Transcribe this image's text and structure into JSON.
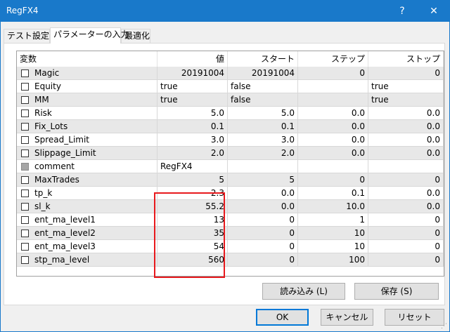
{
  "window": {
    "title": "RegFX4",
    "help_label": "?",
    "close_label": "✕"
  },
  "tabs": [
    {
      "label": "テスト設定"
    },
    {
      "label": "パラメーターの入力"
    },
    {
      "label": "最適化"
    }
  ],
  "table": {
    "headers": [
      "変数",
      "値",
      "スタート",
      "ステップ",
      "ストップ"
    ],
    "rows": [
      {
        "name": "Magic",
        "value": "20191004",
        "start": "20191004",
        "step": "0",
        "stop": "0"
      },
      {
        "name": "Equity",
        "value": "true",
        "start": "false",
        "step": "",
        "stop": "true"
      },
      {
        "name": "MM",
        "value": "true",
        "start": "false",
        "step": "",
        "stop": "true"
      },
      {
        "name": "Risk",
        "value": "5.0",
        "start": "5.0",
        "step": "0.0",
        "stop": "0.0"
      },
      {
        "name": "Fix_Lots",
        "value": "0.1",
        "start": "0.1",
        "step": "0.0",
        "stop": "0.0"
      },
      {
        "name": "Spread_Limit",
        "value": "3.0",
        "start": "3.0",
        "step": "0.0",
        "stop": "0.0"
      },
      {
        "name": "Slippage_Limit",
        "value": "2.0",
        "start": "2.0",
        "step": "0.0",
        "stop": "0.0"
      },
      {
        "name": "comment",
        "value": "RegFX4",
        "start": "",
        "step": "",
        "stop": ""
      },
      {
        "name": "MaxTrades",
        "value": "5",
        "start": "5",
        "step": "0",
        "stop": "0"
      },
      {
        "name": "tp_k",
        "value": "2.3",
        "start": "0.0",
        "step": "0.1",
        "stop": "0.0"
      },
      {
        "name": "sl_k",
        "value": "55.2",
        "start": "0.0",
        "step": "10.0",
        "stop": "0.0"
      },
      {
        "name": "ent_ma_level1",
        "value": "13",
        "start": "0",
        "step": "1",
        "stop": "0"
      },
      {
        "name": "ent_ma_level2",
        "value": "35",
        "start": "0",
        "step": "10",
        "stop": "0"
      },
      {
        "name": "ent_ma_level3",
        "value": "54",
        "start": "0",
        "step": "10",
        "stop": "0"
      },
      {
        "name": "stp_ma_level",
        "value": "560",
        "start": "0",
        "step": "100",
        "stop": "0"
      }
    ]
  },
  "buttons": {
    "load": "読み込み (L)",
    "save": "保存 (S)",
    "ok": "OK",
    "cancel": "キャンセル",
    "reset": "リセット"
  },
  "colors": {
    "titlebar": "#1979ca",
    "highlight": "#e8191d"
  }
}
